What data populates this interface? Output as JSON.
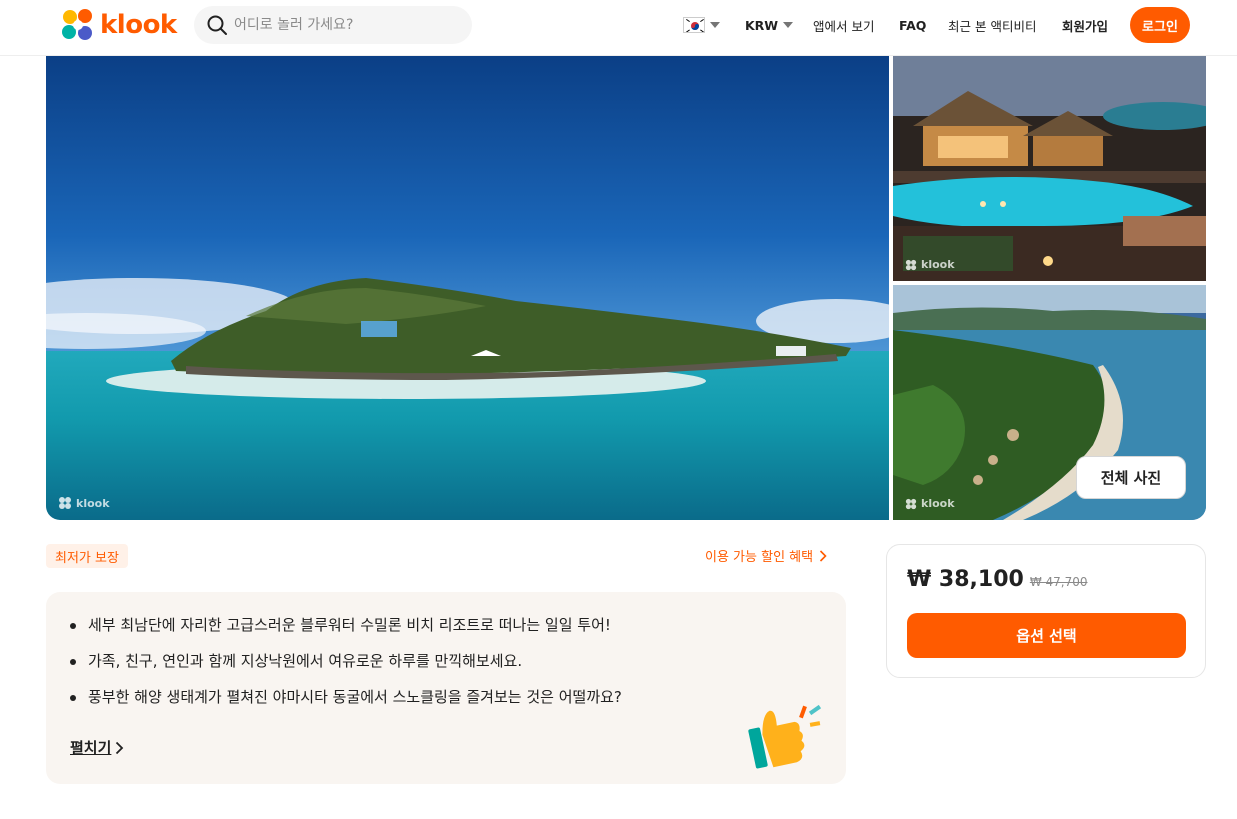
{
  "header": {
    "brand": "klook",
    "search": {
      "placeholder": "어디로 놀러 가세요?"
    },
    "nav": {
      "currency": "KRW",
      "app_link": "앱에서 보기",
      "faq": "FAQ",
      "recent": "최근 본 액티비티",
      "signup": "회원가입",
      "login": "로그인"
    }
  },
  "gallery": {
    "watermark": "klook",
    "all_photos_label": "전체 사진"
  },
  "badge": {
    "label": "최저가 보장"
  },
  "discount_link": {
    "label": "이용 가능 할인 혜택"
  },
  "highlights": {
    "items": [
      "세부 최남단에 자리한 고급스러운 블루워터 수밀론 비치 리조트로 떠나는 일일 투어!",
      "가족, 친구, 연인과 함께 지상낙원에서 여유로운 하루를 만끽해보세요.",
      "풍부한 해양 생태계가 펼쳐진 야마시타 동굴에서 스노클링을 즐겨보는 것은 어떨까요?"
    ],
    "expand_label": "펼치기"
  },
  "price_card": {
    "price": "₩ 38,100",
    "original_price": "₩ 47,700",
    "option_button": "옵션 선택"
  },
  "colors": {
    "brand": "#ff5b00",
    "badge_bg": "#fff1e8",
    "highlight_bg": "#f9f5f1"
  }
}
